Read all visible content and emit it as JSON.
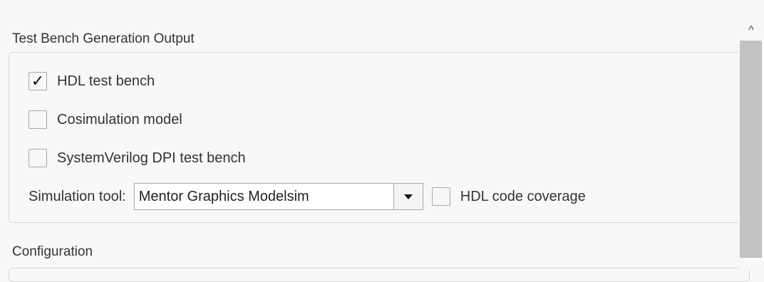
{
  "sections": {
    "testbench_title": "Test Bench Generation Output",
    "configuration_title": "Configuration"
  },
  "options": {
    "hdl_test_bench": {
      "label": "HDL test bench",
      "checked": true,
      "mark": "✓"
    },
    "cosimulation_model": {
      "label": "Cosimulation model",
      "checked": false
    },
    "systemverilog_dpi": {
      "label": "SystemVerilog DPI test bench",
      "checked": false
    },
    "hdl_code_coverage": {
      "label": "HDL code coverage",
      "checked": false
    }
  },
  "simulation_tool": {
    "label": "Simulation tool:",
    "selected": "Mentor Graphics Modelsim"
  },
  "scrollbar": {
    "up_glyph": "^"
  }
}
